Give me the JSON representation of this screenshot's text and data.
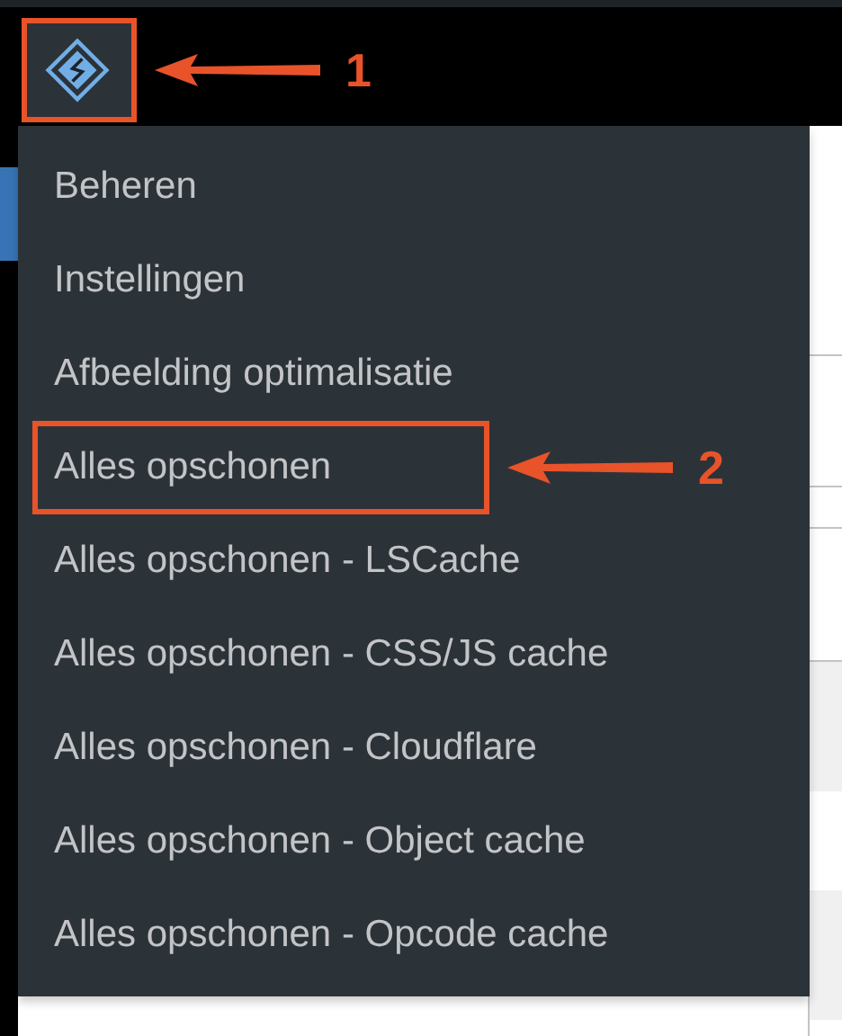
{
  "toolbar": {
    "menu_open": true,
    "callout": "1"
  },
  "menu": {
    "items": [
      {
        "label": "Beheren"
      },
      {
        "label": "Instellingen"
      },
      {
        "label": "Afbeelding optimalisatie"
      },
      {
        "label": "Alles opschonen",
        "callout": "2"
      },
      {
        "label": "Alles opschonen - LSCache"
      },
      {
        "label": "Alles opschonen - CSS/JS cache"
      },
      {
        "label": "Alles opschonen - Cloudflare"
      },
      {
        "label": "Alles opschonen - Object cache"
      },
      {
        "label": "Alles opschonen - Opcode cache"
      }
    ]
  }
}
